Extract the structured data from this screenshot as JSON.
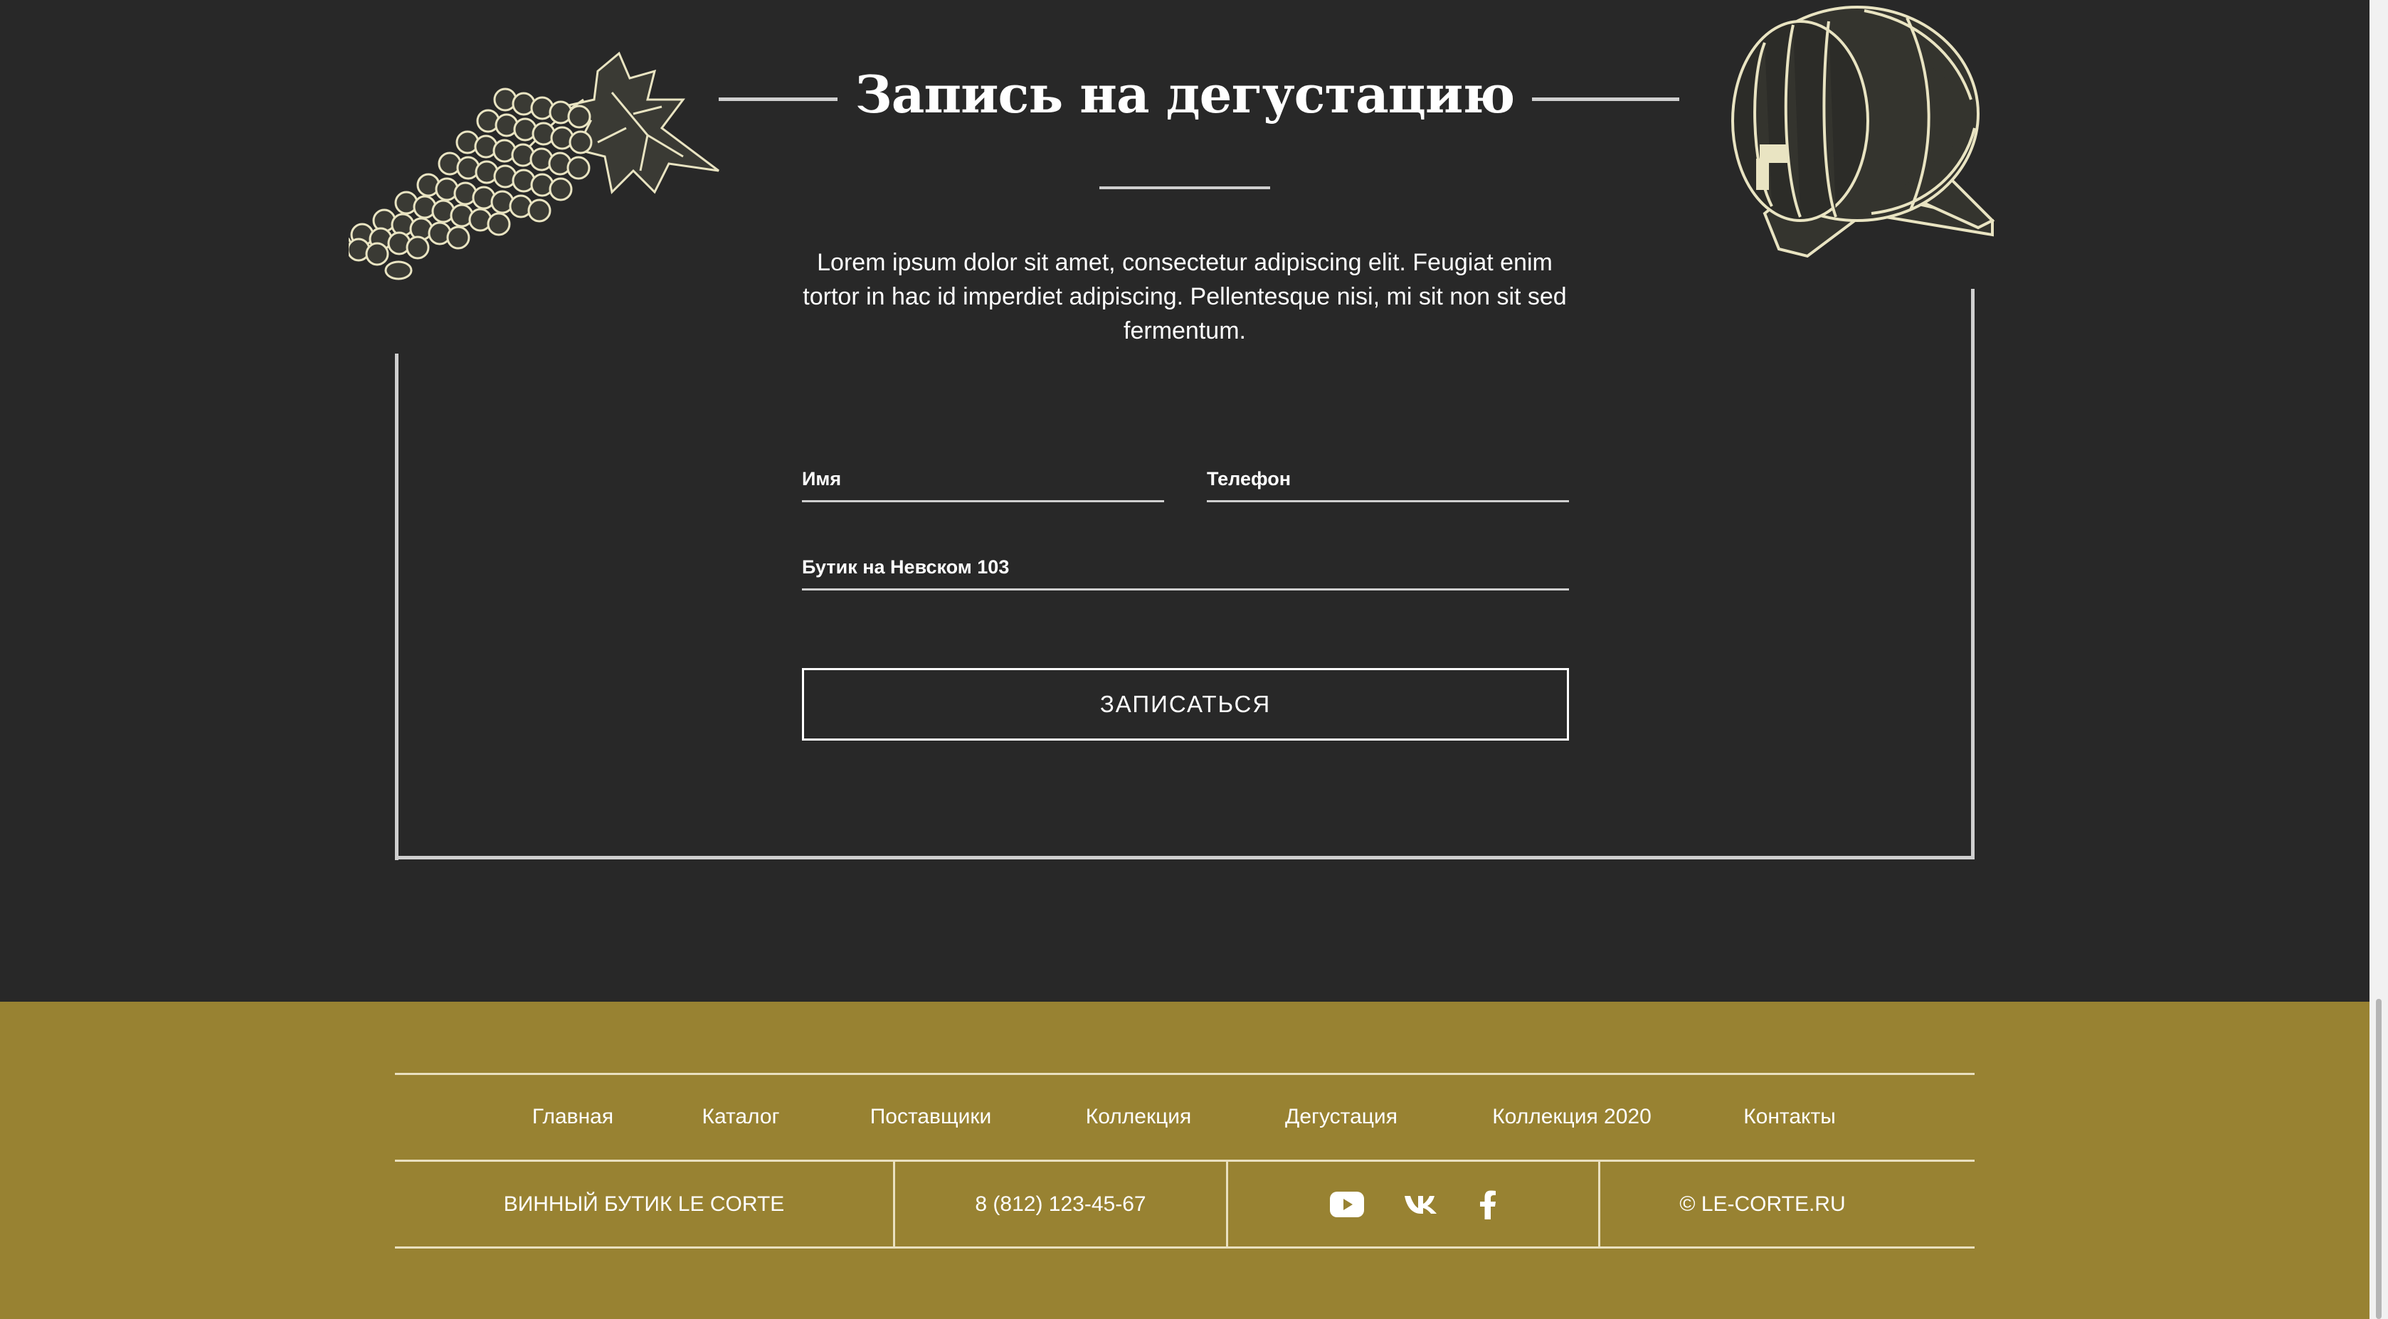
{
  "colors": {
    "background": "#282828",
    "footer_background": "#988232",
    "frame": "#cfcfcf",
    "illustration": "#e9e4c2",
    "text": "#ffffff"
  },
  "tasting": {
    "title": "Запись на дегустацию",
    "intro": "Lorem ipsum dolor sit amet, consectetur adipiscing elit. Feugiat enim tortor in hac id imperdiet adipiscing. Pellentesque nisi, mi sit non sit sed fermentum.",
    "form": {
      "name_placeholder": "Имя",
      "phone_placeholder": "Телефон",
      "boutique_placeholder": "Бутик на Невском 103",
      "submit_label": "ЗАПИСАТЬСЯ"
    },
    "illustrations": [
      "grapes",
      "barrel"
    ]
  },
  "footer": {
    "nav": [
      {
        "label": "Главная"
      },
      {
        "label": "Каталог"
      },
      {
        "label": "Поставщики"
      },
      {
        "label": "Коллекция"
      },
      {
        "label": "Дегустация"
      },
      {
        "label": "Коллекция 2020"
      },
      {
        "label": "Контакты"
      }
    ],
    "brand": "ВИННЫЙ БУТИК LE CORTE",
    "phone": "8 (812) 123-45-67",
    "social_icons": [
      "youtube-icon",
      "vk-icon",
      "facebook-icon"
    ],
    "copyright": "© LE-CORTE.RU"
  }
}
